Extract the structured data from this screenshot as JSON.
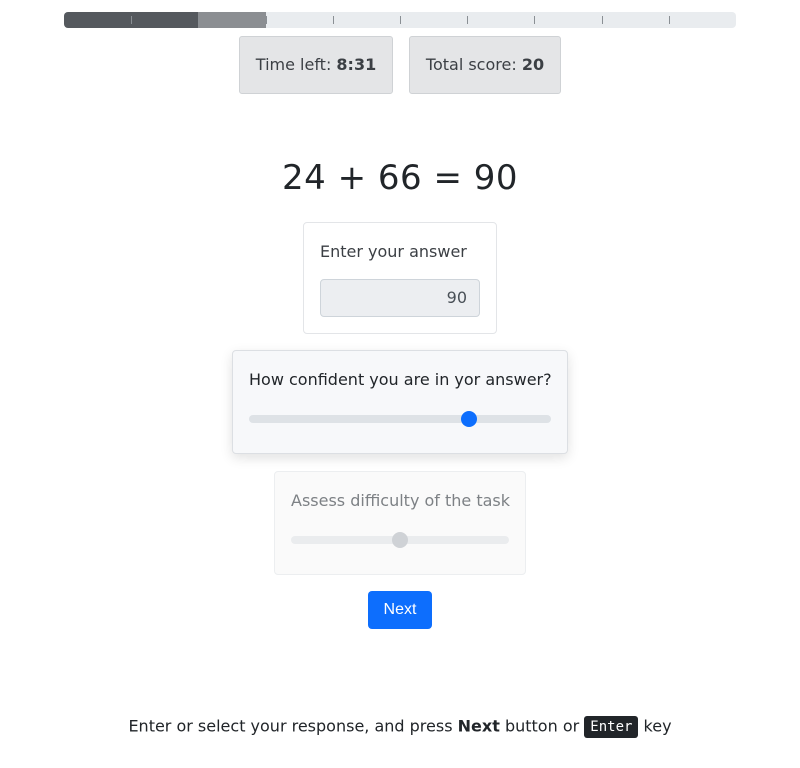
{
  "progress": {
    "total_segments": 10,
    "completed_segments": 2,
    "current_segment": 3,
    "colors": {
      "completed": "#55595e",
      "current": "#8b8e92",
      "remaining": "#e9ecef"
    }
  },
  "stats": {
    "time_left_label": "Time left:",
    "time_left_value": "8:31",
    "total_score_label": "Total score:",
    "total_score_value": "20"
  },
  "task": {
    "equation": "24 + 66 = 90"
  },
  "answer": {
    "label": "Enter your answer",
    "value": "90"
  },
  "confidence": {
    "label": "How confident you are in yor answer?",
    "value_fraction": 0.74,
    "accent": "#0d6efd"
  },
  "difficulty": {
    "label": "Assess difficulty of the task",
    "value_fraction": 0.5,
    "disabled": true
  },
  "next_button": {
    "label": "Next"
  },
  "footer": {
    "text_before": "Enter or select your response, and press",
    "button_word": "Next",
    "text_middle": "button or",
    "key": "Enter",
    "text_after": "key"
  }
}
